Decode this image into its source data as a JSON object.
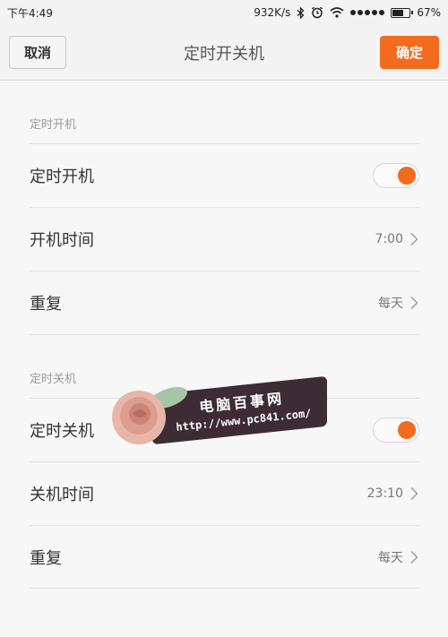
{
  "status_bar": {
    "time": "下午4:49",
    "speed": "932K/s",
    "battery_percent": "67%",
    "battery_level": 0.67
  },
  "header": {
    "cancel_label": "取消",
    "title": "定时开关机",
    "confirm_label": "确定"
  },
  "sections": [
    {
      "label": "定时开机",
      "rows": [
        {
          "label": "定时开机",
          "type": "toggle",
          "on": true
        },
        {
          "label": "开机时间",
          "value": "7:00"
        },
        {
          "label": "重复",
          "value": "每天"
        }
      ]
    },
    {
      "label": "定时关机",
      "rows": [
        {
          "label": "定时关机",
          "type": "toggle",
          "on": true
        },
        {
          "label": "关机时间",
          "value": "23:10"
        },
        {
          "label": "重复",
          "value": "每天"
        }
      ]
    }
  ],
  "watermark": {
    "title": "电脑百事网",
    "url": "http://www.pc841.com/"
  },
  "colors": {
    "accent": "#f36b1c"
  }
}
